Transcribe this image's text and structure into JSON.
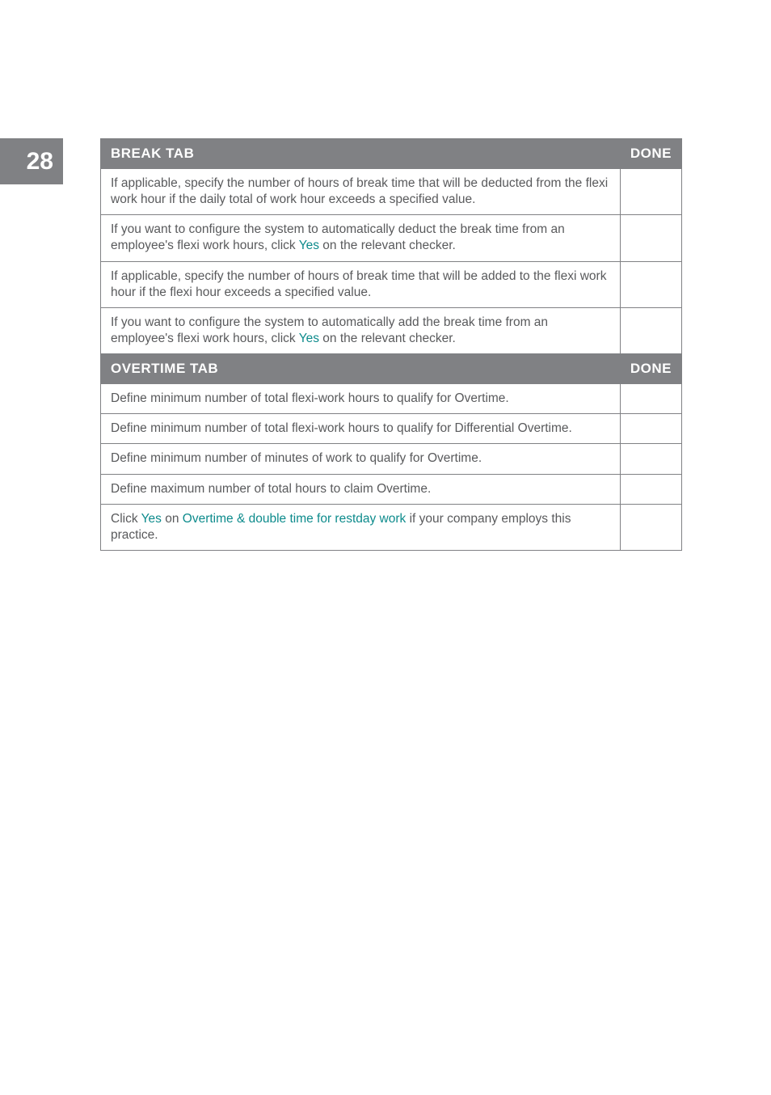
{
  "page_number": "28",
  "headers": {
    "break_tab": "BREAK TAB",
    "overtime_tab": "OVERTIME TAB",
    "done": "DONE"
  },
  "link_words": {
    "yes": "Yes",
    "overtime_restday": "Overtime & double time for restday work"
  },
  "break_rows": [
    {
      "pre": "If applicable, specify the number of hours of break time that will be deducted from the flexi work hour if the daily total of work hour exceeds a specified value."
    },
    {
      "pre": "If you want to configure the system to automatically deduct the break time from an employee's flexi work hours, click ",
      "link": "yes",
      "post": " on the relevant checker."
    },
    {
      "pre": "If applicable, specify the number of hours of break time that will be added to the flexi work hour if the flexi hour exceeds a specified value."
    },
    {
      "pre": "If you want to configure the system to automatically add the break time from an employee's flexi work hours, click ",
      "link": "yes",
      "post": " on the relevant checker."
    }
  ],
  "overtime_rows": [
    {
      "pre": "Define minimum number of total flexi-work hours to qualify for Overtime."
    },
    {
      "pre": "Define minimum number of total flexi-work hours to qualify for Differential Overtime."
    },
    {
      "pre": "Define minimum number of minutes of work to qualify for Overtime."
    },
    {
      "pre": "Define maximum number of total hours to claim Overtime."
    },
    {
      "pre": "Click ",
      "link": "yes",
      "mid": " on ",
      "link2": "overtime_restday",
      "post": " if your company employs this practice."
    }
  ]
}
